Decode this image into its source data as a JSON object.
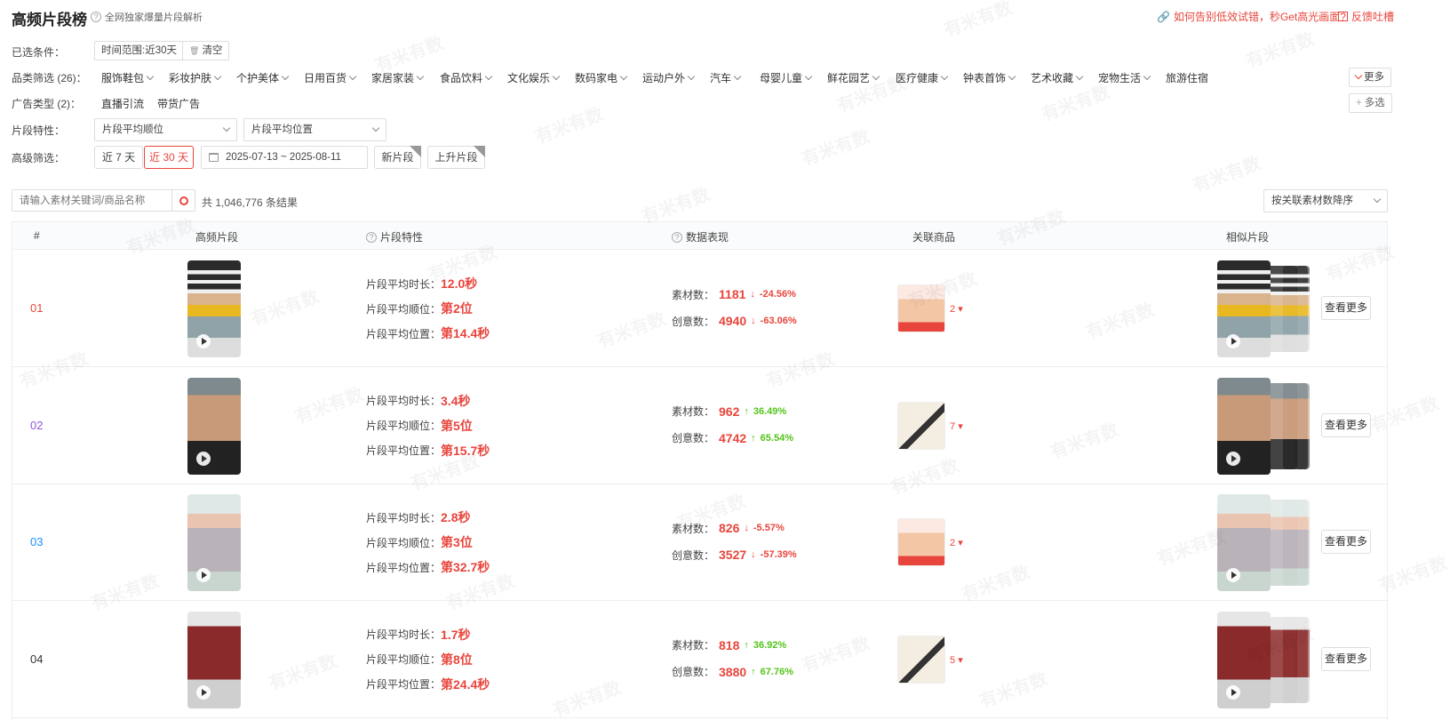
{
  "header": {
    "title": "高频片段榜",
    "subtitle": "全网独家爆量片段解析",
    "link1": "如何告别低效试错，秒Get高光画面?",
    "link2": "反馈吐槽"
  },
  "filters": {
    "selected_label": "已选条件：",
    "selected_chip": "时间范围:近30天",
    "clear": "清空",
    "category_label": "品类筛选 (26)：",
    "categories": [
      "服饰鞋包",
      "彩妆护肤",
      "个护美体",
      "日用百货",
      "家居家装",
      "食品饮料",
      "文化娱乐",
      "数码家电",
      "运动户外",
      "汽车",
      "母婴儿童",
      "鲜花园艺",
      "医疗健康",
      "钟表首饰",
      "艺术收藏",
      "宠物生活",
      "旅游住宿"
    ],
    "more": "更多",
    "ad_label": "广告类型 (2)：",
    "ad_types": [
      "直播引流",
      "带货广告"
    ],
    "multi": "多选",
    "feature_label": "片段特性：",
    "feature_select1": "片段平均顺位",
    "feature_select2": "片段平均位置",
    "advanced_label": "高级筛选：",
    "days7": "近 7 天",
    "days30": "近 30 天",
    "date_range": "2025-07-13 ~ 2025-08-11",
    "new_clip": "新片段",
    "rising_clip": "上升片段"
  },
  "search": {
    "placeholder": "请输入素材关键词/商品名称",
    "result_count": "共 1,046,776 条结果",
    "sort": "按关联素材数降序"
  },
  "table": {
    "headers": [
      "#",
      "高频片段",
      "片段特性",
      "数据表现",
      "关联商品",
      "相似片段"
    ],
    "feat_labels": [
      "片段平均时长：",
      "片段平均顺位：",
      "片段平均位置："
    ],
    "perf_labels": [
      "素材数：",
      "创意数："
    ],
    "more_btn": "查看更多",
    "rows": [
      {
        "rank": "01",
        "rank_color": "#e8453c",
        "duration": "12.0秒",
        "order": "第2位",
        "position": "第14.4秒",
        "material": "1181",
        "material_change": "-24.56%",
        "material_dir": "down",
        "creative": "4940",
        "creative_change": "-63.06%",
        "creative_dir": "down",
        "prod_count": "2"
      },
      {
        "rank": "02",
        "rank_color": "#9254de",
        "duration": "3.4秒",
        "order": "第5位",
        "position": "第15.7秒",
        "material": "962",
        "material_change": "36.49%",
        "material_dir": "up",
        "creative": "4742",
        "creative_change": "65.54%",
        "creative_dir": "up",
        "prod_count": "7"
      },
      {
        "rank": "03",
        "rank_color": "#1890ff",
        "duration": "2.8秒",
        "order": "第3位",
        "position": "第32.7秒",
        "material": "826",
        "material_change": "-5.57%",
        "material_dir": "down",
        "creative": "3527",
        "creative_change": "-57.39%",
        "creative_dir": "down",
        "prod_count": "2"
      },
      {
        "rank": "04",
        "rank_color": "#333333",
        "duration": "1.7秒",
        "order": "第8位",
        "position": "第24.4秒",
        "material": "818",
        "material_change": "36.92%",
        "material_dir": "up",
        "creative": "3880",
        "creative_change": "67.76%",
        "creative_dir": "up",
        "prod_count": "5"
      }
    ]
  },
  "watermark": "有米有数"
}
